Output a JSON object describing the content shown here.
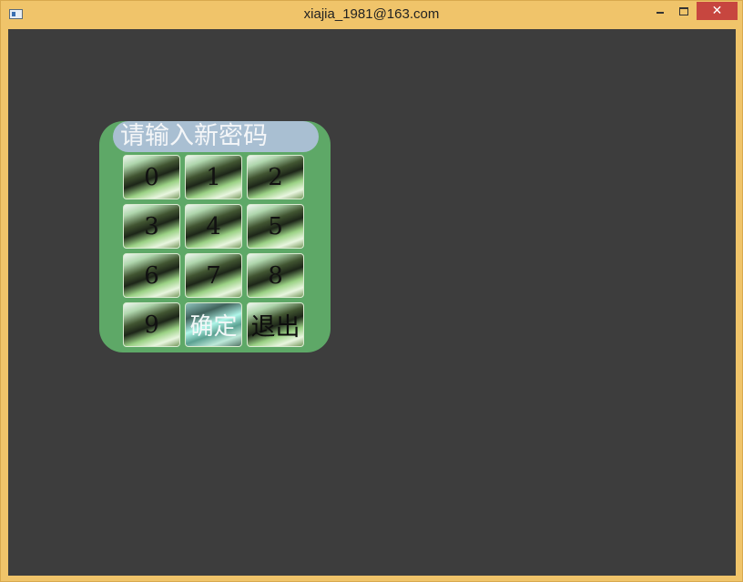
{
  "window": {
    "title": "xiajia_1981@163.com",
    "close_glyph": "✕"
  },
  "dialog": {
    "prompt": "请输入新密码",
    "keys": [
      "0",
      "1",
      "2",
      "3",
      "4",
      "5",
      "6",
      "7",
      "8",
      "9"
    ],
    "confirm_label": "确定",
    "exit_label": "退出"
  },
  "colors": {
    "title_bar": "#f0c46a",
    "client_background": "#3d3d3d",
    "panel": "#5ea867",
    "prompt_background": "#a9bfd2",
    "close_button": "#c7463f"
  },
  "icons": {
    "app": "app-window-icon",
    "minimize": "minimize-icon",
    "maximize": "maximize-icon",
    "close": "close-icon"
  }
}
